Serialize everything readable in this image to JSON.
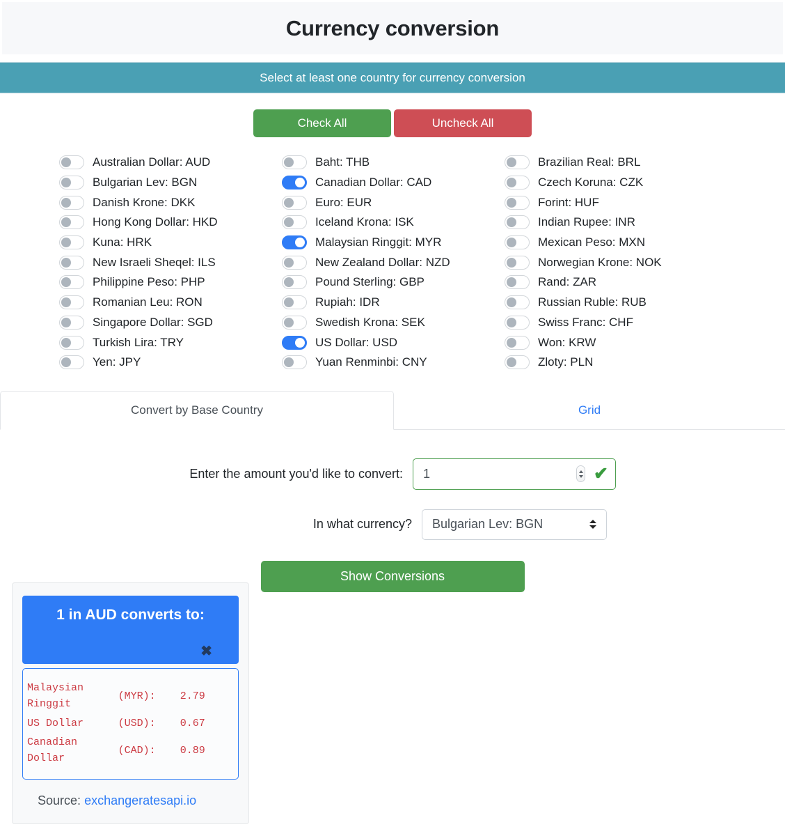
{
  "header": {
    "title": "Currency conversion"
  },
  "alert": {
    "message": "Select at least one country for currency conversion"
  },
  "actions": {
    "check_all_label": "Check All",
    "uncheck_all_label": "Uncheck All"
  },
  "currencies": {
    "col1": [
      {
        "label": "Australian Dollar: AUD",
        "on": false
      },
      {
        "label": "Bulgarian Lev: BGN",
        "on": false
      },
      {
        "label": "Danish Krone: DKK",
        "on": false
      },
      {
        "label": "Hong Kong Dollar: HKD",
        "on": false
      },
      {
        "label": "Kuna: HRK",
        "on": false
      },
      {
        "label": "New Israeli Sheqel: ILS",
        "on": false
      },
      {
        "label": "Philippine Peso: PHP",
        "on": false
      },
      {
        "label": "Romanian Leu: RON",
        "on": false
      },
      {
        "label": "Singapore Dollar: SGD",
        "on": false
      },
      {
        "label": "Turkish Lira: TRY",
        "on": false
      },
      {
        "label": "Yen: JPY",
        "on": false
      }
    ],
    "col2": [
      {
        "label": "Baht: THB",
        "on": false
      },
      {
        "label": "Canadian Dollar: CAD",
        "on": true
      },
      {
        "label": "Euro: EUR",
        "on": false
      },
      {
        "label": "Iceland Krona: ISK",
        "on": false
      },
      {
        "label": "Malaysian Ringgit: MYR",
        "on": true
      },
      {
        "label": "New Zealand Dollar: NZD",
        "on": false
      },
      {
        "label": "Pound Sterling: GBP",
        "on": false
      },
      {
        "label": "Rupiah: IDR",
        "on": false
      },
      {
        "label": "Swedish Krona: SEK",
        "on": false
      },
      {
        "label": "US Dollar: USD",
        "on": true
      },
      {
        "label": "Yuan Renminbi: CNY",
        "on": false
      }
    ],
    "col3": [
      {
        "label": "Brazilian Real: BRL",
        "on": false
      },
      {
        "label": "Czech Koruna: CZK",
        "on": false
      },
      {
        "label": "Forint: HUF",
        "on": false
      },
      {
        "label": "Indian Rupee: INR",
        "on": false
      },
      {
        "label": "Mexican Peso: MXN",
        "on": false
      },
      {
        "label": "Norwegian Krone: NOK",
        "on": false
      },
      {
        "label": "Rand: ZAR",
        "on": false
      },
      {
        "label": "Russian Ruble: RUB",
        "on": false
      },
      {
        "label": "Swiss Franc: CHF",
        "on": false
      },
      {
        "label": "Won: KRW",
        "on": false
      },
      {
        "label": "Zloty: PLN",
        "on": false
      }
    ]
  },
  "tabs": [
    {
      "label": "Convert by Base Country",
      "active": true
    },
    {
      "label": "Grid",
      "active": false
    }
  ],
  "form": {
    "amount_label": "Enter the amount you'd like to convert:",
    "amount_value": "1",
    "currency_label": "In what currency?",
    "currency_value": "Bulgarian Lev: BGN",
    "submit_label": "Show Conversions"
  },
  "result": {
    "title": "1 in AUD converts to:",
    "close_glyph": "✖",
    "rows": [
      {
        "name": "Malaysian Ringgit",
        "code": "(MYR):",
        "value": "2.79"
      },
      {
        "name": "US Dollar",
        "code": "(USD):",
        "value": "0.67"
      },
      {
        "name": "Canadian Dollar",
        "code": "(CAD):",
        "value": "0.89"
      }
    ],
    "source_prefix": "Source:",
    "source_link": "exchangeratesapi.io"
  },
  "colors": {
    "accent_blue": "#2f7cf6",
    "teal": "#4aa0b4",
    "green": "#4e9f50",
    "red": "#ce4e55",
    "rate_text": "#cc3b43"
  }
}
